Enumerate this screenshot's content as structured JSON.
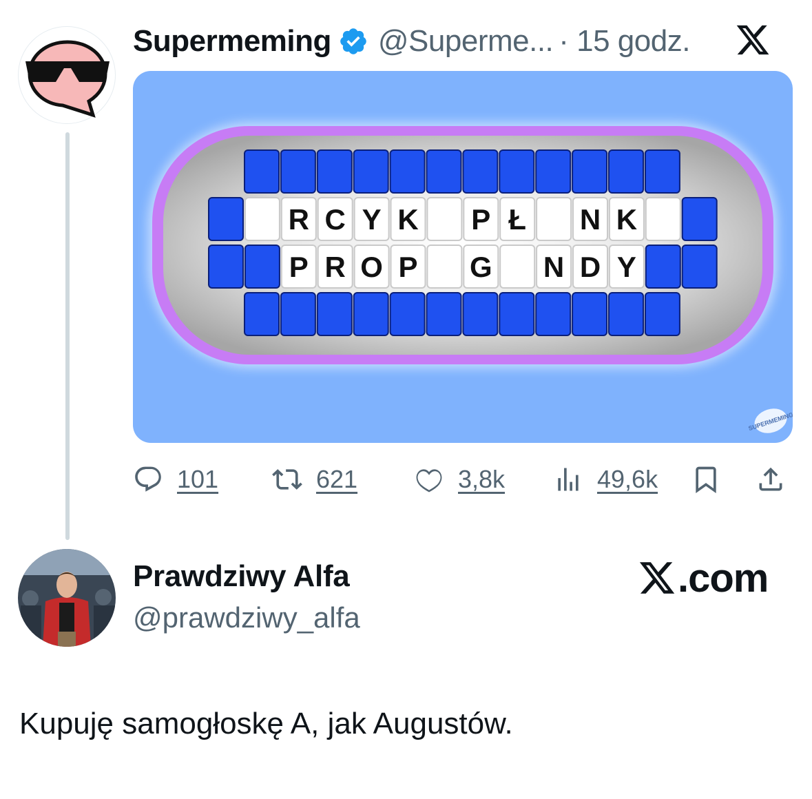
{
  "tweet": {
    "author_name": "Supermeming",
    "author_handle": "@Superme...",
    "time": "· 15 godz.",
    "avatar_icon": "sunglasses-speech-bubble-avatar",
    "board": {
      "row1": [
        "",
        "",
        "",
        "",
        "",
        "",
        "",
        "",
        "",
        "",
        "",
        ""
      ],
      "row2": [
        "",
        "",
        "R",
        "C",
        "Y",
        "K",
        "",
        "P",
        "Ł",
        "",
        "N",
        "K",
        "",
        ""
      ],
      "row3": [
        "",
        "",
        "P",
        "R",
        "O",
        "P",
        "",
        "G",
        "",
        "N",
        "D",
        "Y",
        "",
        ""
      ],
      "row4": [
        "",
        "",
        "",
        "",
        "",
        "",
        "",
        "",
        "",
        "",
        "",
        ""
      ],
      "watermark": "SUPERMEMING"
    },
    "stats": {
      "replies": "101",
      "reposts": "621",
      "likes": "3,8k",
      "views": "49,6k"
    }
  },
  "reply": {
    "author_name": "Prawdziwy Alfa",
    "author_handle": "@prawdziwy_alfa",
    "source": ".com",
    "text": "Kupuję samogłoskę A, jak Augustów."
  },
  "colors": {
    "board_background": "#7fb2fd",
    "tile_blue": "#1f51f0",
    "frame_purple": "#c77cf5",
    "verified_blue": "#1d9bf0"
  }
}
